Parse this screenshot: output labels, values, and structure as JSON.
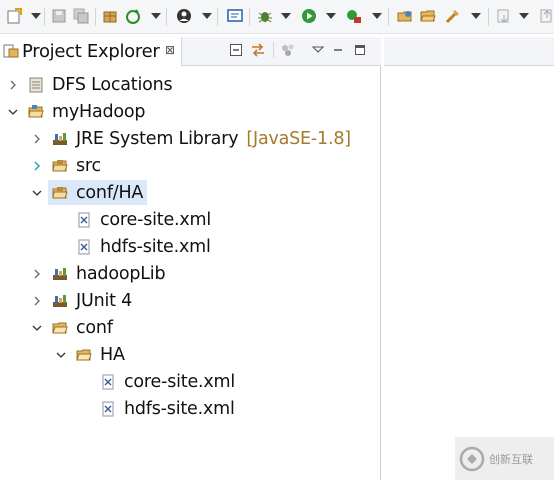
{
  "view": {
    "title": "Project Explorer",
    "close_glyph": "⊠"
  },
  "tree": {
    "dfs": {
      "label": "DFS Locations",
      "icon": "dfs-locations-icon"
    },
    "project": {
      "label": "myHadoop",
      "icon": "project-folder-icon"
    },
    "jre": {
      "label": "JRE System Library",
      "decoration": "[JavaSE-1.8]",
      "icon": "library-icon"
    },
    "src": {
      "label": "src",
      "icon": "source-folder-icon"
    },
    "conf_ha": {
      "label": "conf/HA",
      "icon": "source-folder-icon"
    },
    "conf_ha_core": {
      "label": "core-site.xml",
      "icon": "xml-file-icon"
    },
    "conf_ha_hdfs": {
      "label": "hdfs-site.xml",
      "icon": "xml-file-icon"
    },
    "hadooplib": {
      "label": "hadoopLib",
      "icon": "library-icon"
    },
    "junit": {
      "label": "JUnit 4",
      "icon": "library-icon"
    },
    "conf": {
      "label": "conf",
      "icon": "folder-open-icon"
    },
    "ha": {
      "label": "HA",
      "icon": "folder-open-icon"
    },
    "ha_core": {
      "label": "core-site.xml",
      "icon": "xml-file-icon"
    },
    "ha_hdfs": {
      "label": "hdfs-site.xml",
      "icon": "xml-file-icon"
    }
  },
  "watermark": {
    "text": "创新互联"
  },
  "colors": {
    "selection": "#dbe8f9",
    "decoration": "#a57a2c",
    "tab_bar": "#f3f5f8"
  }
}
